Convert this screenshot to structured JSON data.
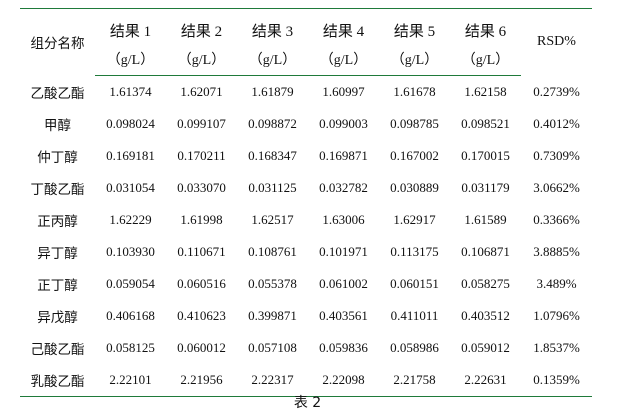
{
  "table": {
    "name_header": "组分名称",
    "result_headers": [
      "结果 1",
      "结果 2",
      "结果 3",
      "结果 4",
      "结果 5",
      "结果 6"
    ],
    "unit": "（g/L）",
    "rsd_header": "RSD%",
    "rows": [
      {
        "name": "乙酸乙酯",
        "values": [
          "1.61374",
          "1.62071",
          "1.61879",
          "1.60997",
          "1.61678",
          "1.62158"
        ],
        "rsd": "0.2739%"
      },
      {
        "name": "甲醇",
        "values": [
          "0.098024",
          "0.099107",
          "0.098872",
          "0.099003",
          "0.098785",
          "0.098521"
        ],
        "rsd": "0.4012%"
      },
      {
        "name": "仲丁醇",
        "values": [
          "0.169181",
          "0.170211",
          "0.168347",
          "0.169871",
          "0.167002",
          "0.170015"
        ],
        "rsd": "0.7309%"
      },
      {
        "name": "丁酸乙酯",
        "values": [
          "0.031054",
          "0.033070",
          "0.031125",
          "0.032782",
          "0.030889",
          "0.031179"
        ],
        "rsd": "3.0662%"
      },
      {
        "name": "正丙醇",
        "values": [
          "1.62229",
          "1.61998",
          "1.62517",
          "1.63006",
          "1.62917",
          "1.61589"
        ],
        "rsd": "0.3366%"
      },
      {
        "name": "异丁醇",
        "values": [
          "0.103930",
          "0.110671",
          "0.108761",
          "0.101971",
          "0.113175",
          "0.106871"
        ],
        "rsd": "3.8885%"
      },
      {
        "name": "正丁醇",
        "values": [
          "0.059054",
          "0.060516",
          "0.055378",
          "0.061002",
          "0.060151",
          "0.058275"
        ],
        "rsd": "3.489%"
      },
      {
        "name": "异戊醇",
        "values": [
          "0.406168",
          "0.410623",
          "0.399871",
          "0.403561",
          "0.411011",
          "0.403512"
        ],
        "rsd": "1.0796%"
      },
      {
        "name": "己酸乙酯",
        "values": [
          "0.058125",
          "0.060012",
          "0.057108",
          "0.059836",
          "0.058986",
          "0.059012"
        ],
        "rsd": "1.8537%"
      },
      {
        "name": "乳酸乙酯",
        "values": [
          "2.22101",
          "2.21956",
          "2.22317",
          "2.22098",
          "2.21758",
          "2.22631"
        ],
        "rsd": "0.1359%"
      }
    ]
  },
  "caption": "表 2",
  "colors": {
    "rule": "#1f7a3a",
    "text": "#111111"
  }
}
